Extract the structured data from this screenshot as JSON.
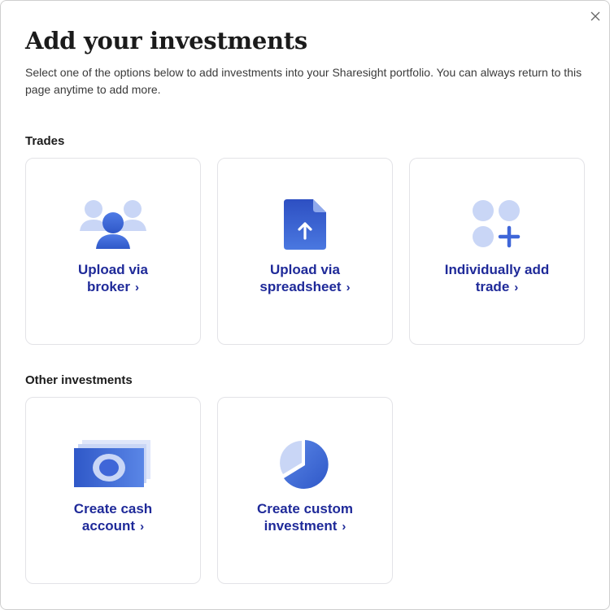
{
  "modal": {
    "title": "Add your investments",
    "description": "Select one of the options below to add investments into your Sharesight portfolio. You can always return to this page anytime to add more.",
    "close_icon": "close-icon"
  },
  "sections": {
    "trades": {
      "heading": "Trades",
      "cards": {
        "broker": {
          "line1": "Upload via",
          "line2": "broker",
          "icon": "people-icon"
        },
        "spreadsheet": {
          "line1": "Upload via",
          "line2": "spreadsheet",
          "icon": "upload-file-icon"
        },
        "trade": {
          "line1": "Individually add",
          "line2": "trade",
          "icon": "add-trade-icon"
        }
      }
    },
    "other": {
      "heading": "Other investments",
      "cards": {
        "cash": {
          "line1": "Create cash",
          "line2": "account",
          "icon": "banknote-icon"
        },
        "custom": {
          "line1": "Create custom",
          "line2": "investment",
          "icon": "pie-chart-icon"
        }
      }
    }
  },
  "chevron": "›",
  "colors": {
    "accent": "#1f2a99",
    "icon_primary": "#3f66d8",
    "icon_light": "#c9d6f6"
  }
}
